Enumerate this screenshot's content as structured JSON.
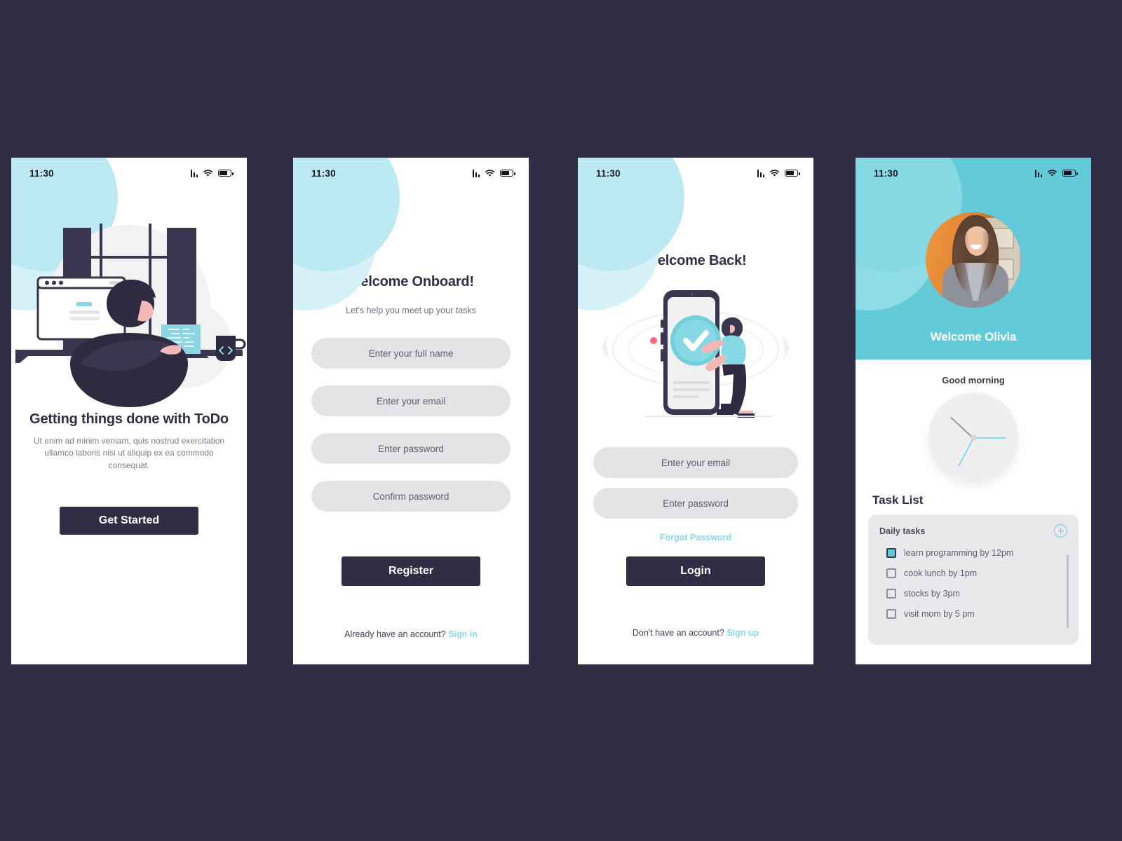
{
  "meta": {
    "background_color": "#312D44",
    "accent_teal": "#63CBD8",
    "accent_light_blue": "#8BD7EA",
    "dark": "#312D44",
    "field_gray": "#E4E4E6"
  },
  "status_bar": {
    "time": "11:30",
    "icons": [
      "signal-icon",
      "wifi-icon",
      "battery-icon"
    ]
  },
  "screen1": {
    "name": "onboarding-intro",
    "illustration": "person-at-desk-illustration",
    "title": "Getting things done with ToDo",
    "paragraph": "Ut enim ad minim veniam, quis nostrud exercitation ullamco laboris nisi ut aliquip ex ea commodo consequat.",
    "cta": "Get Started"
  },
  "screen2": {
    "name": "register",
    "title": "Welcome Onboard!",
    "subtitle": "Let's help you meet up your tasks",
    "fields": [
      {
        "name": "full-name-input",
        "placeholder": "Enter your full name"
      },
      {
        "name": "email-input",
        "placeholder": "Enter your email"
      },
      {
        "name": "password-input",
        "placeholder": "Enter password"
      },
      {
        "name": "confirm-password-input",
        "placeholder": "Confirm password"
      }
    ],
    "cta": "Register",
    "footer_text": "Already have an account?",
    "footer_link": "Sign in"
  },
  "screen3": {
    "name": "login",
    "title": "Welcome Back!",
    "illustration": "woman-with-phone-checkmark-illustration",
    "fields": [
      {
        "name": "email-input",
        "placeholder": "Enter your email"
      },
      {
        "name": "password-input",
        "placeholder": "Enter password"
      }
    ],
    "forgot_link": "Forgot Password",
    "cta": "Login",
    "footer_text": "Don't have an account?",
    "footer_link": "Sign up"
  },
  "screen4": {
    "name": "home-dashboard",
    "avatar": "user-avatar-photo",
    "welcome": "Welcome Olivia",
    "greeting": "Good morning",
    "clock": "analog-clock",
    "section_title": "Task List",
    "card_title": "Daily tasks",
    "add_label": "add-task-icon",
    "tasks": [
      {
        "label": "learn programming by 12pm",
        "checked": true
      },
      {
        "label": "cook lunch by 1pm",
        "checked": false
      },
      {
        "label": "stocks by 3pm",
        "checked": false
      },
      {
        "label": "visit mom by 5 pm",
        "checked": false
      }
    ]
  }
}
